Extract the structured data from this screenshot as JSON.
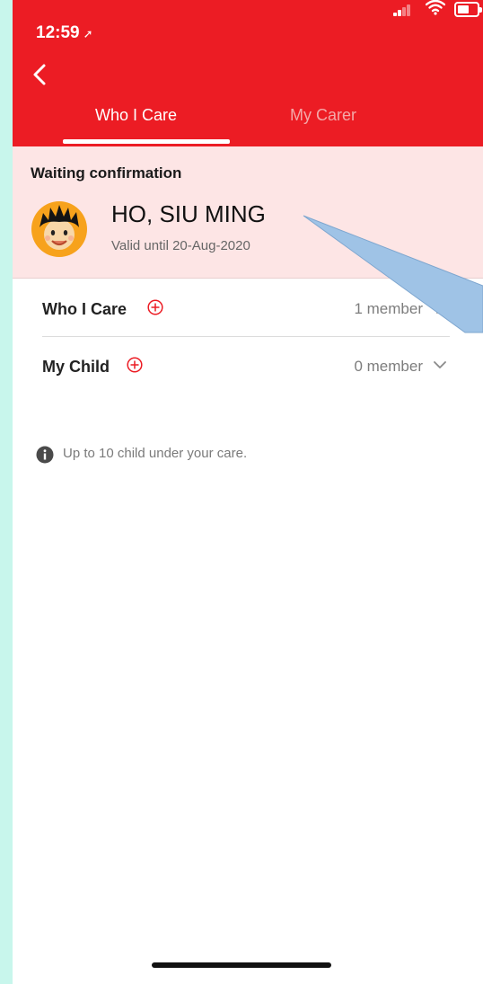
{
  "status_bar": {
    "time": "12:59",
    "location_arrow": "➚"
  },
  "tabs": [
    {
      "label": "Who I Care",
      "active": true
    },
    {
      "label": "My Carer",
      "active": false
    }
  ],
  "waiting": {
    "title": "Waiting confirmation",
    "person": {
      "name": "HO, SIU MING",
      "valid_until": "Valid until 20-Aug-2020"
    }
  },
  "sections": [
    {
      "label": "Who I Care",
      "count": "1 member",
      "chevron": "right"
    },
    {
      "label": "My Child",
      "count": "0 member",
      "chevron": "down"
    }
  ],
  "info": {
    "text": "Up to 10 child under your care."
  },
  "colors": {
    "brand_red": "#ec1c24",
    "waiting_bg": "#fde5e5",
    "page_bg": "#c8f6ec",
    "callout_blue": "#9fc3e6"
  }
}
